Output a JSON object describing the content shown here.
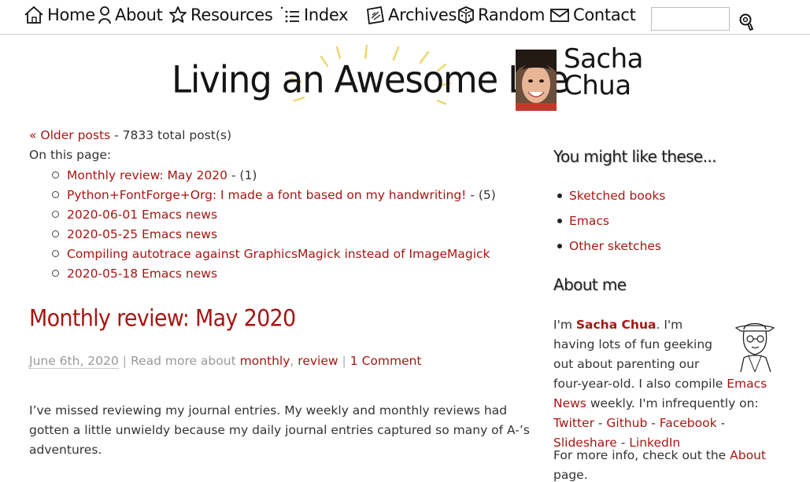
{
  "nav": {
    "items": [
      {
        "label": "Home",
        "icon": "house-icon"
      },
      {
        "label": "About",
        "icon": "person-icon"
      },
      {
        "label": "Resources",
        "icon": "star-icon"
      },
      {
        "label": "Index",
        "icon": "list-icon"
      },
      {
        "label": "Archives",
        "icon": "calendar-icon"
      },
      {
        "label": "Random",
        "icon": "dice-icon"
      },
      {
        "label": "Contact",
        "icon": "envelope-icon"
      }
    ],
    "search": {
      "value": "",
      "icon": "magnifier-icon"
    }
  },
  "banner": {
    "title": "Living an Awesome Life",
    "name_line1": "Sacha",
    "name_line2": "Chua"
  },
  "main": {
    "older_posts": "« Older posts",
    "total_posts": "- 7833 total post(s)",
    "on_this_page": "On this page:",
    "toc": [
      {
        "title": "Monthly review: May 2020",
        "suffix": " - (1)"
      },
      {
        "title": "Python+FontForge+Org: I made a font based on my handwriting!",
        "suffix": " - (5)"
      },
      {
        "title": "2020-06-01 Emacs news",
        "suffix": ""
      },
      {
        "title": "2020-05-25 Emacs news",
        "suffix": ""
      },
      {
        "title": "Compiling autotrace against GraphicsMagick instead of ImageMagick",
        "suffix": ""
      },
      {
        "title": "2020-05-18 Emacs news",
        "suffix": ""
      }
    ],
    "post": {
      "title": "Monthly review: May 2020",
      "date": "June 6th, 2020",
      "sep1": "|",
      "read_more": "Read more about",
      "tag1": "monthly",
      "comma": ",",
      "tag2": "review",
      "sep2": "|",
      "comments": "1 Comment",
      "body": "I’ve missed reviewing my journal entries. My weekly and monthly reviews had gotten a little unwieldy because my daily journal entries captured so many of A-’s adventures."
    }
  },
  "sidebar": {
    "heading1": "You might like these...",
    "links": [
      "Sketched books",
      "Emacs",
      "Other sketches"
    ],
    "heading2": "About me",
    "about": {
      "p1": "I'm ",
      "name": "Sacha Chua",
      "p2": ". I'm having lots of fun geeking out about parenting our four-year-old. I also compile ",
      "emacs_news": "Emacs News",
      "p3": " weekly. I'm infrequently on: ",
      "twitter": "Twitter",
      "d1": " - ",
      "github": "Github",
      "d2": " - ",
      "facebook": "Facebook",
      "d3": " -",
      "slideshare": "Slideshare",
      "d4": " - ",
      "linkedin": "LinkedIn"
    },
    "more_info": "For more info, check out the ",
    "about_link": "About",
    "more_info_end": "page."
  },
  "colors": {
    "link": "#a51713",
    "text": "#333333",
    "meta": "#999999"
  }
}
